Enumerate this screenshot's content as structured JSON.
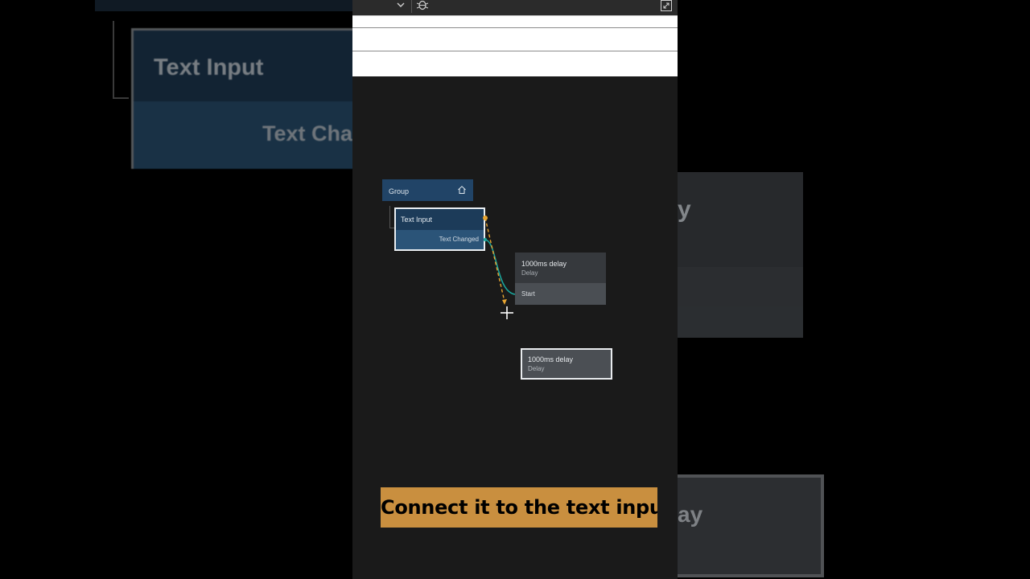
{
  "background": {
    "text_input_title": "Text Input",
    "text_changed_label": "Text Char",
    "delay_fragment": "y",
    "delay_fragment2": "ay"
  },
  "toolbar": {
    "chevron_icon": "chevron-down-icon",
    "debug_icon": "bug-icon",
    "expand_icon": "expand-icon"
  },
  "canvas": {
    "group": {
      "label": "Group",
      "icon": "home-icon"
    },
    "text_input_node": {
      "title": "Text Input",
      "output_port": "Text Changed"
    },
    "delay_node": {
      "title": "1000ms delay",
      "subtitle": "Delay",
      "input_port": "Start"
    },
    "dragged_delay_node": {
      "title": "1000ms delay",
      "subtitle": "Delay"
    },
    "wire_colors": {
      "signal": "#e8a531",
      "data": "#1aa39a"
    }
  },
  "caption": {
    "text": "Connect it to the text input",
    "background": "#c98f3f"
  }
}
